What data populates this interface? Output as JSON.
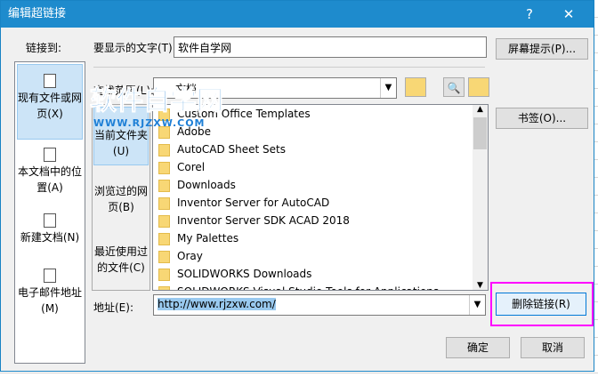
{
  "title": "编辑超链接",
  "help": "?",
  "close": "✕",
  "link_to": "链接到:",
  "left_items": [
    {
      "label": "现有文件或网页(X)"
    },
    {
      "label": "本文档中的位置(A)"
    },
    {
      "label": "新建文档(N)"
    },
    {
      "label": "电子邮件地址(M)"
    }
  ],
  "display_text_label": "要显示的文字(T):",
  "display_text_value": "软件自学网",
  "screentip": "屏幕提示(P)...",
  "look_in_label": "查找范围(L):",
  "look_in_value": "文档",
  "sub_items": [
    {
      "label": "当前文件夹(U)"
    },
    {
      "label": "浏览过的网页(B)"
    },
    {
      "label": "最近使用过的文件(C)"
    }
  ],
  "files": [
    "Custom Office Templates",
    "Adobe",
    "AutoCAD Sheet Sets",
    "Corel",
    "Downloads",
    "Inventor Server for AutoCAD",
    "Inventor Server SDK ACAD 2018",
    "My Palettes",
    "Oray",
    "SOLIDWORKS Downloads",
    "SOLIDWORKS Visual Studio Tools for Applications"
  ],
  "bookmark": "书签(O)...",
  "address_label": "地址(E):",
  "address_value": "http://www.rjzxw.com/",
  "remove_link": "删除链接(R)",
  "ok": "确定",
  "cancel": "取消",
  "watermark": "软件自学网",
  "watermark_url": "WWW.RJZXW.COM"
}
